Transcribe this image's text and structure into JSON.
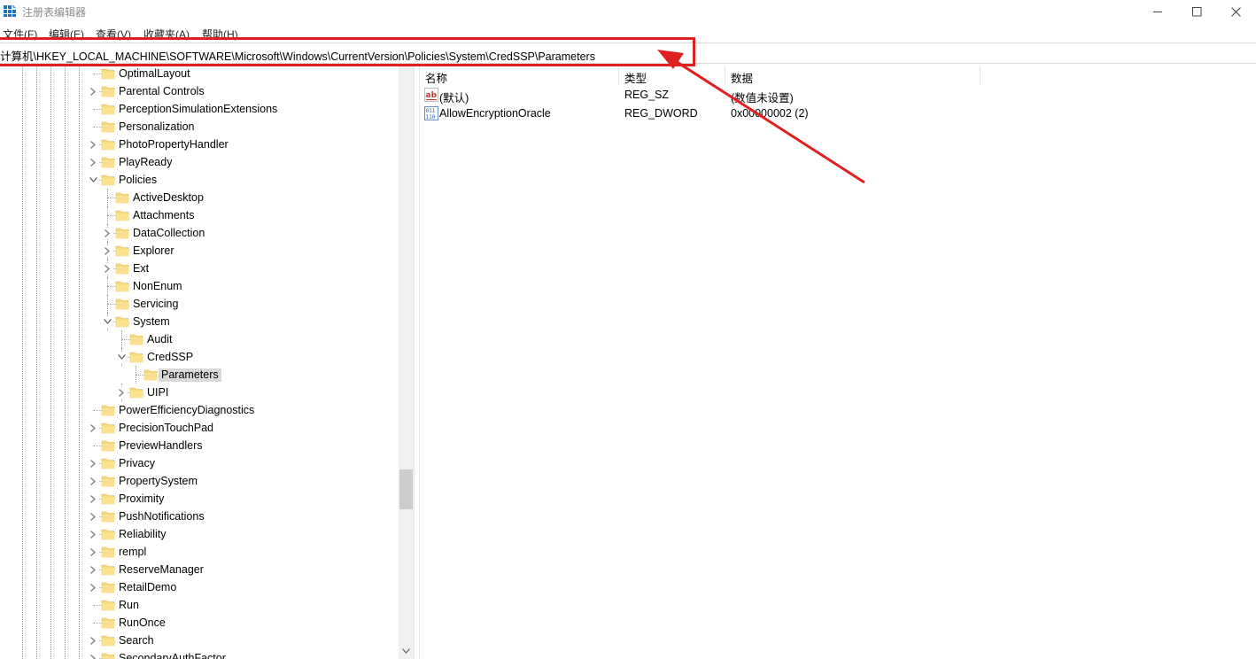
{
  "window": {
    "title": "注册表编辑器",
    "controls": [
      "minimize-icon",
      "maximize-icon",
      "close-icon"
    ]
  },
  "menu": [
    "文件(F)",
    "编辑(E)",
    "查看(V)",
    "收藏夹(A)",
    "帮助(H)"
  ],
  "address": "计算机\\HKEY_LOCAL_MACHINE\\SOFTWARE\\Microsoft\\Windows\\CurrentVersion\\Policies\\System\\CredSSP\\Parameters",
  "tree": [
    {
      "label": "OptimalLayout",
      "level": 0,
      "expander": "none"
    },
    {
      "label": "Parental Controls",
      "level": 0,
      "expander": "collapsed"
    },
    {
      "label": "PerceptionSimulationExtensions",
      "level": 0,
      "expander": "none"
    },
    {
      "label": "Personalization",
      "level": 0,
      "expander": "none"
    },
    {
      "label": "PhotoPropertyHandler",
      "level": 0,
      "expander": "collapsed"
    },
    {
      "label": "PlayReady",
      "level": 0,
      "expander": "collapsed"
    },
    {
      "label": "Policies",
      "level": 0,
      "expander": "expanded"
    },
    {
      "label": "ActiveDesktop",
      "level": 1,
      "expander": "none"
    },
    {
      "label": "Attachments",
      "level": 1,
      "expander": "none"
    },
    {
      "label": "DataCollection",
      "level": 1,
      "expander": "collapsed"
    },
    {
      "label": "Explorer",
      "level": 1,
      "expander": "collapsed"
    },
    {
      "label": "Ext",
      "level": 1,
      "expander": "collapsed"
    },
    {
      "label": "NonEnum",
      "level": 1,
      "expander": "none"
    },
    {
      "label": "Servicing",
      "level": 1,
      "expander": "none"
    },
    {
      "label": "System",
      "level": 1,
      "expander": "expanded"
    },
    {
      "label": "Audit",
      "level": 2,
      "expander": "none"
    },
    {
      "label": "CredSSP",
      "level": 2,
      "expander": "expanded"
    },
    {
      "label": "Parameters",
      "level": 3,
      "expander": "none",
      "selected": true
    },
    {
      "label": "UIPI",
      "level": 2,
      "expander": "collapsed"
    },
    {
      "label": "PowerEfficiencyDiagnostics",
      "level": 0,
      "expander": "none"
    },
    {
      "label": "PrecisionTouchPad",
      "level": 0,
      "expander": "collapsed"
    },
    {
      "label": "PreviewHandlers",
      "level": 0,
      "expander": "none"
    },
    {
      "label": "Privacy",
      "level": 0,
      "expander": "collapsed"
    },
    {
      "label": "PropertySystem",
      "level": 0,
      "expander": "collapsed"
    },
    {
      "label": "Proximity",
      "level": 0,
      "expander": "collapsed"
    },
    {
      "label": "PushNotifications",
      "level": 0,
      "expander": "collapsed"
    },
    {
      "label": "Reliability",
      "level": 0,
      "expander": "collapsed"
    },
    {
      "label": "rempl",
      "level": 0,
      "expander": "collapsed"
    },
    {
      "label": "ReserveManager",
      "level": 0,
      "expander": "collapsed"
    },
    {
      "label": "RetailDemo",
      "level": 0,
      "expander": "collapsed"
    },
    {
      "label": "Run",
      "level": 0,
      "expander": "none"
    },
    {
      "label": "RunOnce",
      "level": 0,
      "expander": "none"
    },
    {
      "label": "Search",
      "level": 0,
      "expander": "collapsed"
    },
    {
      "label": "SecondaryAuthFactor",
      "level": 0,
      "expander": "collapsed"
    }
  ],
  "list": {
    "columns": [
      "名称",
      "类型",
      "数据"
    ],
    "rows": [
      {
        "icon": "string-value-icon",
        "name": "(默认)",
        "type": "REG_SZ",
        "data": "(数值未设置)"
      },
      {
        "icon": "dword-value-icon",
        "name": "AllowEncryptionOracle",
        "type": "REG_DWORD",
        "data": "0x00000002 (2)"
      }
    ]
  },
  "colors": {
    "annotation": "#e02020",
    "folder": "#f8d775",
    "selection": "#d9d9d9"
  }
}
